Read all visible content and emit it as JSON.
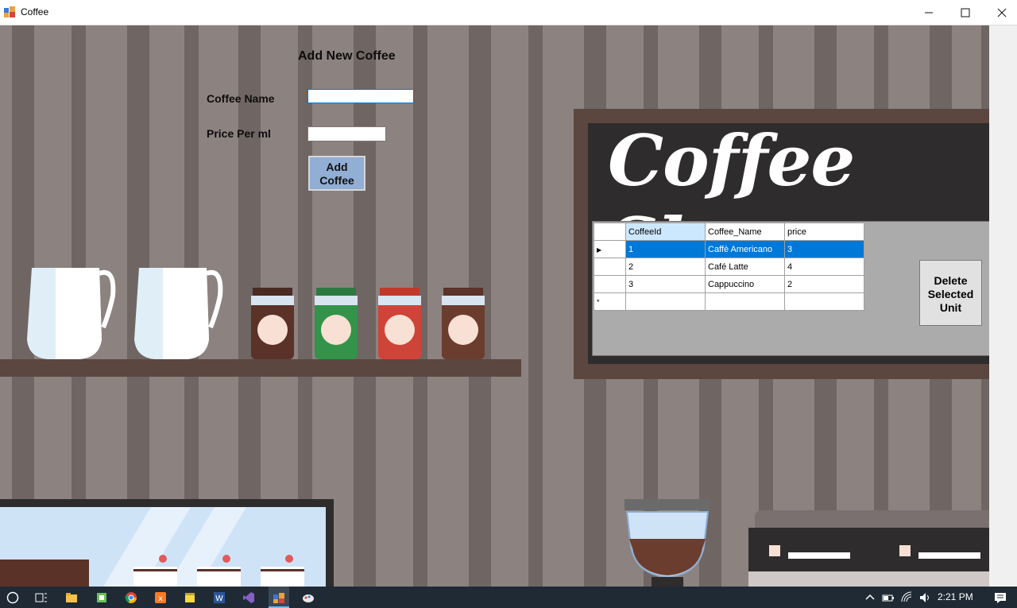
{
  "window": {
    "title": "Coffee",
    "minimize_icon": "minimize-icon",
    "maximize_icon": "maximize-icon",
    "close_icon": "close-icon"
  },
  "form": {
    "heading": "Add New Coffee",
    "coffee_name_label": "Coffee Name",
    "coffee_name_value": "",
    "price_label": "Price Per ml",
    "price_value": "",
    "add_button_label": "Add\nCoffee"
  },
  "board": {
    "title": "Coffee Shop"
  },
  "grid": {
    "columns": [
      "CoffeeId",
      "Coffee_Name",
      "price"
    ],
    "rows": [
      {
        "id": "1",
        "name": "Caffè Americano",
        "price": "3",
        "selected": true
      },
      {
        "id": "2",
        "name": "Café Latte",
        "price": "4",
        "selected": false
      },
      {
        "id": "3",
        "name": "Cappuccino",
        "price": "2",
        "selected": false
      }
    ],
    "new_row_marker": "*",
    "current_row_marker": "▶"
  },
  "delete_button_label": "Delete\nSelected\nUnit",
  "taskbar": {
    "clock": "2:21 PM",
    "icons": [
      "start-icon",
      "task-view-icon",
      "file-explorer-icon",
      "app-icon",
      "chrome-icon",
      "xampp-icon",
      "sticky-notes-icon",
      "word-icon",
      "visual-studio-icon",
      "coffee-app-icon",
      "paint-icon"
    ]
  },
  "colors": {
    "background": "#8c8280",
    "stripe": "#6f6563",
    "shelf": "#5b4640",
    "board": "#2e2c2c",
    "button_blue": "#91aed4",
    "selection": "#0078d7"
  }
}
